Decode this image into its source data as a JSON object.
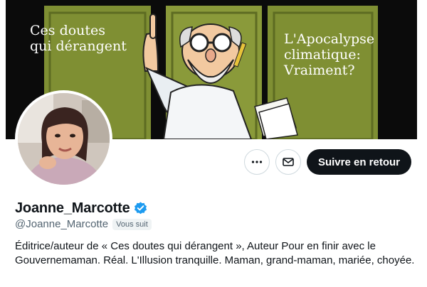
{
  "banner": {
    "left_text_line1": "Ces doutes",
    "left_text_line2": "qui dérangent",
    "right_text_line1": "L'Apocalypse",
    "right_text_line2": "climatique:",
    "right_text_line3": "Vraiment?"
  },
  "actions": {
    "more_icon": "more-icon",
    "message_icon": "mail-icon",
    "follow_label": "Suivre en retour"
  },
  "profile": {
    "display_name": "Joanne_Marcotte",
    "verified_icon": "verified-badge-icon",
    "handle": "@Joanne_Marcotte",
    "follows_you_badge": "Vous suit",
    "bio": "Éditrice/auteur de « Ces doutes qui dérangent », Auteur Pour en finir avec le Gouvernemaman. Réal. L'Illusion tranquille. Maman, grand-maman, mariée, choyée."
  },
  "colors": {
    "verified_blue": "#1d9bf0",
    "follow_button": "#0f1419",
    "secondary_text": "#536471",
    "banner_green": "#8a9a3a"
  }
}
